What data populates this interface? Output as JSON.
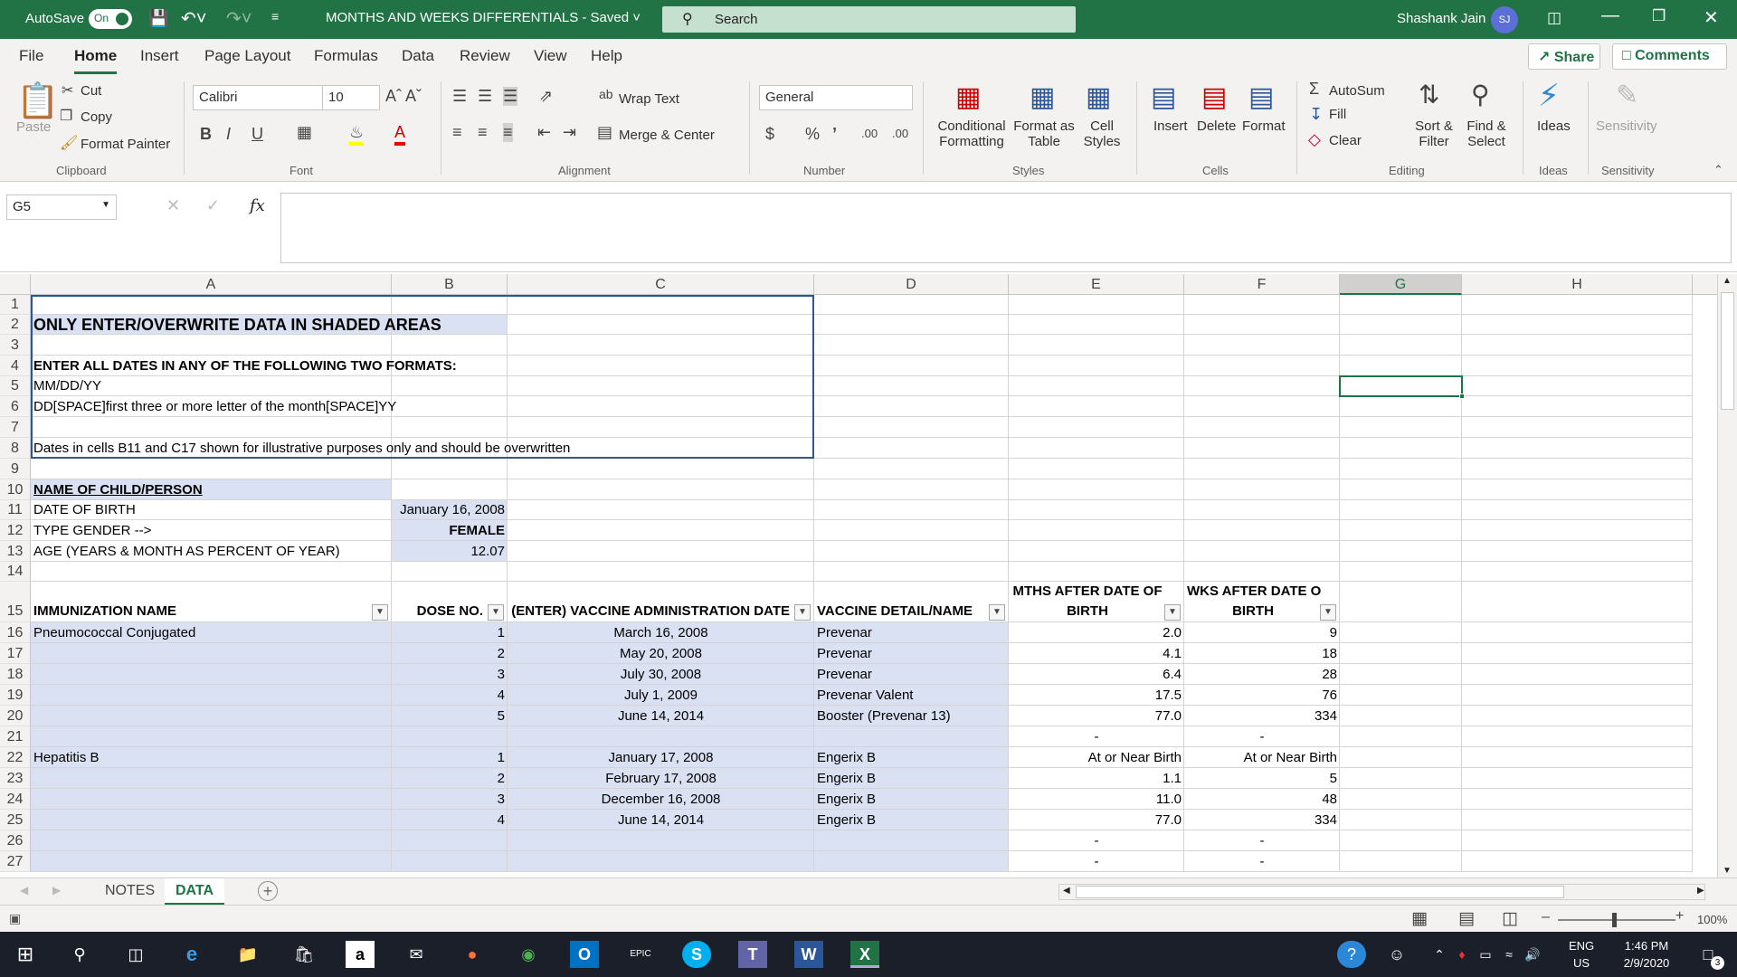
{
  "titlebar": {
    "autosave": "AutoSave",
    "autosave_state": "On",
    "doc_title": "MONTHS AND WEEKS DIFFERENTIALS  -  Saved",
    "search_placeholder": "Search",
    "user_name": "Shashank Jain",
    "user_initials": "SJ"
  },
  "tabs": [
    "File",
    "Home",
    "Insert",
    "Page Layout",
    "Formulas",
    "Data",
    "Review",
    "View",
    "Help"
  ],
  "share": "Share",
  "comments": "Comments",
  "ribbon": {
    "clipboard": {
      "paste": "Paste",
      "cut": "Cut",
      "copy": "Copy",
      "format_painter": "Format Painter",
      "group": "Clipboard"
    },
    "font": {
      "name": "Calibri",
      "size": "10",
      "group": "Font"
    },
    "alignment": {
      "wrap": "Wrap Text",
      "merge": "Merge & Center",
      "group": "Alignment"
    },
    "number": {
      "format": "General",
      "group": "Number"
    },
    "styles": {
      "conditional": "Conditional",
      "formatting": "Formatting",
      "format_as": "Format as",
      "table": "Table",
      "cell": "Cell",
      "styles": "Styles",
      "group": "Styles"
    },
    "cells": {
      "insert": "Insert",
      "delete": "Delete",
      "format": "Format",
      "group": "Cells"
    },
    "editing": {
      "autosum": "AutoSum",
      "fill": "Fill",
      "clear": "Clear",
      "sort": "Sort &",
      "filter": "Filter",
      "find": "Find &",
      "select": "Select",
      "group": "Editing"
    },
    "ideas": {
      "label": "Ideas",
      "group": "Ideas"
    },
    "sensitivity": {
      "label": "Sensitivity",
      "group": "Sensitivity"
    }
  },
  "formula_bar": {
    "name_box": "G5",
    "fx": "fx",
    "content": ""
  },
  "columns": [
    "A",
    "B",
    "C",
    "D",
    "E",
    "F",
    "G",
    "H"
  ],
  "rows": [
    "1",
    "2",
    "3",
    "4",
    "5",
    "6",
    "7",
    "8",
    "9",
    "10",
    "11",
    "12",
    "13",
    "14",
    "15",
    "16",
    "17",
    "18",
    "19",
    "20",
    "21",
    "22",
    "23",
    "24",
    "25",
    "26",
    "27"
  ],
  "cells": {
    "a2": "ONLY ENTER/OVERWRITE DATA IN SHADED AREAS",
    "a4": "ENTER ALL DATES IN ANY OF THE FOLLOWING TWO FORMATS:",
    "a5": "MM/DD/YY",
    "a6": "DD[SPACE]first three or more letter of the month[SPACE]YY",
    "a8": "Dates in cells B11 and C17 shown for illustrative purposes only and should be overwritten",
    "a10": "NAME OF CHILD/PERSON",
    "a11": "DATE OF BIRTH",
    "b11": "January 16, 2008",
    "a12": "TYPE GENDER -->",
    "b12": "FEMALE",
    "a13": "AGE (YEARS & MONTH AS PERCENT OF YEAR)",
    "b13": "12.07",
    "h15a": "IMMUNIZATION NAME",
    "h15b": "DOSE NO.",
    "h15c": "(ENTER) VACCINE ADMINISTRATION DATE",
    "h15d": "VACCINE DETAIL/NAME",
    "h15e1": "MTHS AFTER DATE OF",
    "h15e2": "BIRTH",
    "h15f1": "WKS AFTER DATE OF",
    "h15f2": "BIRTH"
  },
  "table_rows": [
    {
      "row": "16",
      "a": "Pneumococcal Conjugated",
      "b": "1",
      "c": "March 16, 2008",
      "d": "Prevenar",
      "e": "2.0",
      "f": "9"
    },
    {
      "row": "17",
      "a": "",
      "b": "2",
      "c": "May 20, 2008",
      "d": "Prevenar",
      "e": "4.1",
      "f": "18"
    },
    {
      "row": "18",
      "a": "",
      "b": "3",
      "c": "July 30, 2008",
      "d": "Prevenar",
      "e": "6.4",
      "f": "28"
    },
    {
      "row": "19",
      "a": "",
      "b": "4",
      "c": "July 1, 2009",
      "d": "Prevenar Valent",
      "e": "17.5",
      "f": "76"
    },
    {
      "row": "20",
      "a": "",
      "b": "5",
      "c": "June 14, 2014",
      "d": "Booster (Prevenar 13)",
      "e": "77.0",
      "f": "334"
    },
    {
      "row": "21",
      "a": "",
      "b": "",
      "c": "",
      "d": "",
      "e": "-",
      "f": "-"
    },
    {
      "row": "22",
      "a": "Hepatitis B",
      "b": "1",
      "c": "January 17, 2008",
      "d": "Engerix B",
      "e": "At or Near Birth",
      "f": "At or Near Birth"
    },
    {
      "row": "23",
      "a": "",
      "b": "2",
      "c": "February 17, 2008",
      "d": "Engerix B",
      "e": "1.1",
      "f": "5"
    },
    {
      "row": "24",
      "a": "",
      "b": "3",
      "c": "December 16, 2008",
      "d": "Engerix B",
      "e": "11.0",
      "f": "48"
    },
    {
      "row": "25",
      "a": "",
      "b": "4",
      "c": "June 14, 2014",
      "d": "Engerix B",
      "e": "77.0",
      "f": "334"
    },
    {
      "row": "26",
      "a": "",
      "b": "",
      "c": "",
      "d": "",
      "e": "-",
      "f": "-"
    },
    {
      "row": "27",
      "a": "",
      "b": "",
      "c": "",
      "d": "",
      "e": "-",
      "f": "-"
    }
  ],
  "sheets": [
    "NOTES",
    "DATA"
  ],
  "status": {
    "zoom": "100%"
  },
  "taskbar": {
    "lang": "ENG",
    "region": "US",
    "time": "1:46 PM",
    "date": "2/9/2020",
    "notif_count": "3"
  },
  "colors": {
    "excel_green": "#217346",
    "shade": "#d9e1f2",
    "taskbar": "#1b1f2a"
  }
}
